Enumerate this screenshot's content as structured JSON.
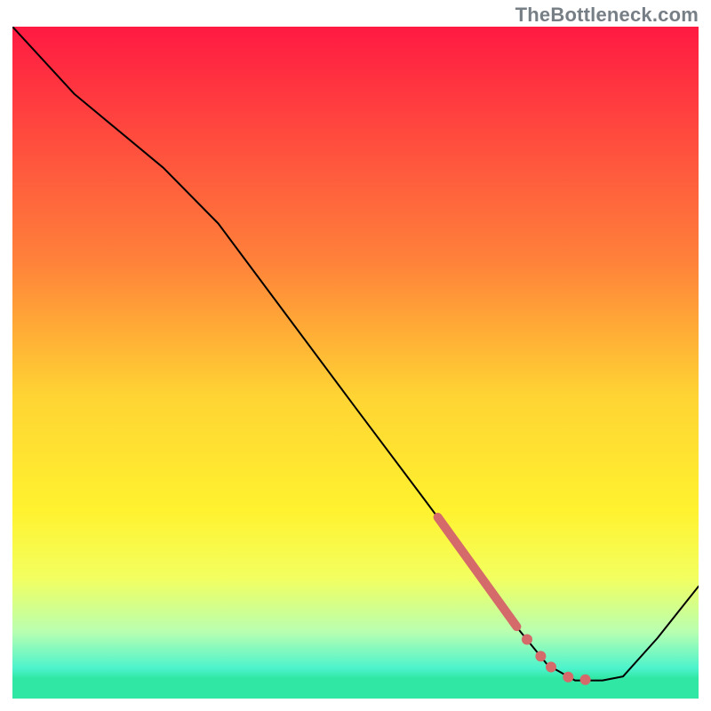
{
  "watermark": "TheBottleneck.com",
  "chart_data": {
    "type": "line",
    "title": "",
    "xlabel": "",
    "ylabel": "",
    "xlim": [
      0,
      100
    ],
    "ylim": [
      0,
      100
    ],
    "grid": false,
    "legend": false,
    "background_gradient": {
      "stops": [
        {
          "offset": 0.0,
          "color": "#ff1a42"
        },
        {
          "offset": 0.35,
          "color": "#ff823a"
        },
        {
          "offset": 0.55,
          "color": "#ffd433"
        },
        {
          "offset": 0.72,
          "color": "#fff22f"
        },
        {
          "offset": 0.82,
          "color": "#f3ff5f"
        },
        {
          "offset": 0.9,
          "color": "#b9ffb0"
        },
        {
          "offset": 0.955,
          "color": "#4cf3cc"
        },
        {
          "offset": 0.97,
          "color": "#30e7a4"
        },
        {
          "offset": 1.0,
          "color": "#30e7a4"
        }
      ]
    },
    "series": [
      {
        "name": "curve",
        "type": "line",
        "color": "#000000",
        "width": 2,
        "points": [
          {
            "x": 0,
            "y": 100
          },
          {
            "x": 9,
            "y": 90
          },
          {
            "x": 22,
            "y": 79
          },
          {
            "x": 30,
            "y": 70.7
          },
          {
            "x": 40,
            "y": 57
          },
          {
            "x": 50,
            "y": 43.3
          },
          {
            "x": 60,
            "y": 29.7
          },
          {
            "x": 68,
            "y": 18.7
          },
          {
            "x": 74,
            "y": 10
          },
          {
            "x": 78,
            "y": 5
          },
          {
            "x": 82,
            "y": 2.7
          },
          {
            "x": 86,
            "y": 2.7
          },
          {
            "x": 89,
            "y": 3.3
          },
          {
            "x": 94,
            "y": 9
          },
          {
            "x": 100,
            "y": 16.7
          }
        ]
      },
      {
        "name": "highlight-segment",
        "type": "line",
        "color": "#d46a6a",
        "width": 10,
        "points": [
          {
            "x": 62,
            "y": 27
          },
          {
            "x": 73.5,
            "y": 10.7
          }
        ]
      },
      {
        "name": "markers",
        "type": "scatter",
        "color": "#d46a6a",
        "radius": 6,
        "points": [
          {
            "x": 75,
            "y": 8.8
          },
          {
            "x": 77,
            "y": 6.3
          },
          {
            "x": 78.5,
            "y": 4.7
          },
          {
            "x": 81,
            "y": 3.2
          },
          {
            "x": 83.5,
            "y": 2.8
          }
        ]
      }
    ]
  }
}
